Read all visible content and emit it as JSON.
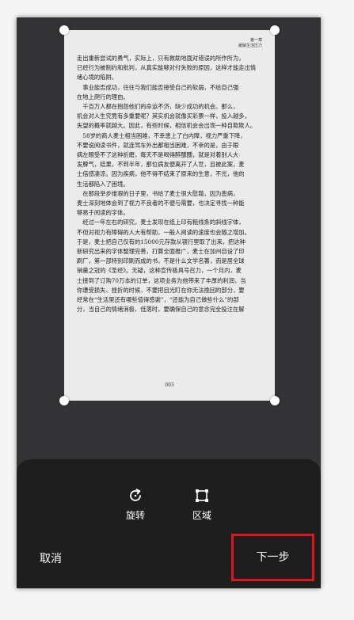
{
  "document": {
    "header_lines": [
      "第一章",
      "缓解生活压力"
    ],
    "lines": [
      "走出重新尝试的勇气，实际上，只有救助地面对错误的所作所为，",
      "已经行为被制约和批判，从真实能够对付失败的原因，这样才能走出情",
      "绪心境的陷阱。",
      "　事业能否成功，往往与我们能否接受自己的软弱，不给自己强",
      "在地上爬行的理由。",
      "　千百万人都在抱怨他们的命运不济，缺少成功的机会。那么，",
      "机会对人生究竟有多重要呢？其实机会就像买彩票一样，投入越多，",
      "失望的概率就越大。因此，有些时候，相信机会会出现一种自欺欺人。",
      "　58岁的商人麦士相当困难，不幸患上了白内障，视力严重下降，",
      "不要说阅读书件，就连驾车外出都相当困难，不幸的是，由于眼",
      "病左眼受不了这种折磨，每天不是喝得醉醺醺，就是对着别人大",
      "发脾气，结果，不到半年，那位病友便离开了人世，且被此案，麦",
      "士倍感凄凉。因为疾病，他不得不结束了原来的生意，不光，他的",
      "生活都陷入了困境。",
      "　在那段举步维艰的日子里，书给了麦士很大慰藉，因为患病，",
      "麦士深刻地体会到了视力不良者的不便与需要，也决定寻找一种能",
      "够易于阅读的字体。",
      "　经过一年左右的研究，麦士发现在纸上印有粗线条的斜线字体，",
      "不但对视力有障碍的人大有帮助，一般人阅读的速度也会随之增加。",
      "于是，麦士把自己仅有的15000元存款从银行里取了出来，把这种",
      "新研究出来的字体整理完善，打算全面推广，麦士在加州自设了印",
      "刷厂，第一部特别印刷而成的书，不是什么文学名著，而是居全球",
      "销量之冠的《圣经》。无疑，这种宣传极具号召力，一个月内，麦",
      "士接到了订购70万本的订单，这项业务为他带来了丰厚的利润，当",
      "你遭受损失、挫折的时候，不要把目光盯在你无法挽回的部分，要",
      "经常在“生活里还有哪些值得感谢”，“还能为自己做些什么”的部",
      "分，当自己的情绪消极、低落时，要确保自己的意念完全投注在解"
    ],
    "page_number": "003"
  },
  "toolbar": {
    "rotate_label": "旋转",
    "area_label": "区域"
  },
  "footer": {
    "cancel_label": "取消",
    "next_label": "下一步"
  },
  "colors": {
    "background": "#333335",
    "panel": "#1e1e1e",
    "highlight_border": "#e0141e",
    "text": "#ffffff"
  },
  "icons": {
    "rotate": "rotate-icon",
    "area": "crop-area-icon"
  }
}
